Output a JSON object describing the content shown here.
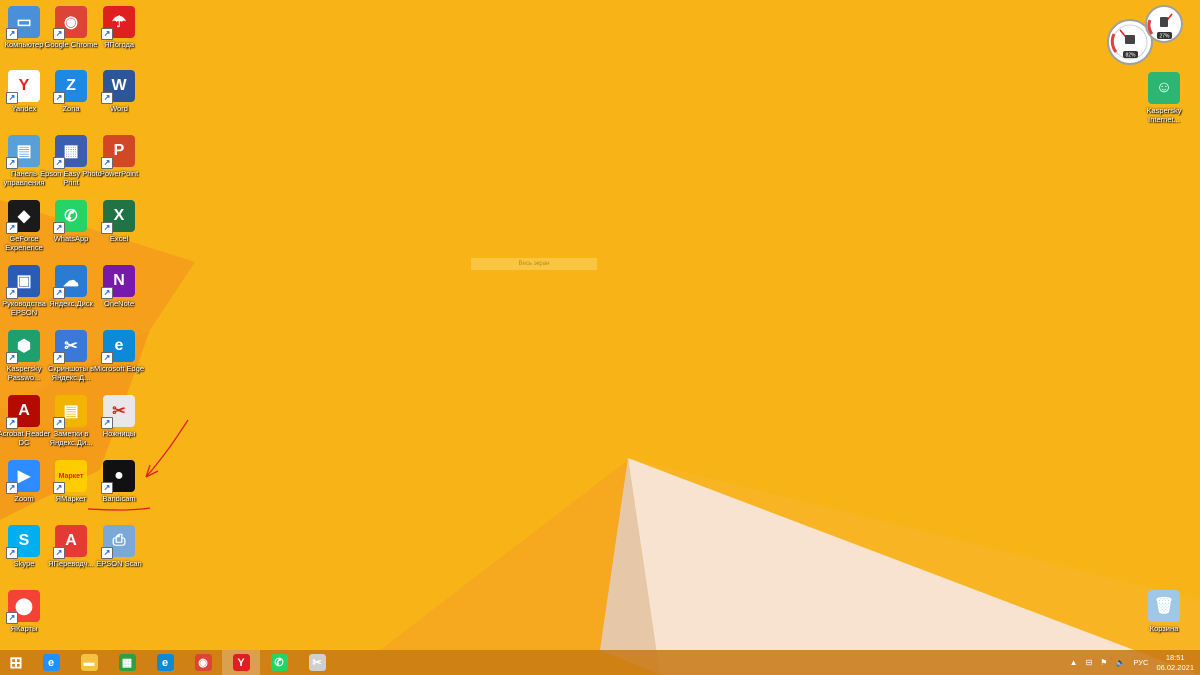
{
  "desktop": {
    "icons": [
      {
        "label": "Компьютер",
        "icon": "computer-icon",
        "color": "#4a8fd8",
        "glyph": "▭"
      },
      {
        "label": "Google Chrome",
        "icon": "chrome-icon",
        "color": "#db4437",
        "glyph": "◉"
      },
      {
        "label": "ЯПогода",
        "icon": "umbrella-icon",
        "color": "#e02020",
        "glyph": "☂"
      },
      {
        "label": "Yandex",
        "icon": "yandex-browser-icon",
        "color": "#ffffff",
        "glyph": "Y"
      },
      {
        "label": "Zona",
        "icon": "zona-icon",
        "color": "#1e88e5",
        "glyph": "Z"
      },
      {
        "label": "Word",
        "icon": "word-icon",
        "color": "#2b579a",
        "glyph": "W"
      },
      {
        "label": "Панель управления",
        "icon": "control-panel-icon",
        "color": "#5aa0d8",
        "glyph": "▤"
      },
      {
        "label": "Epson Easy Photo Print",
        "icon": "epson-photo-icon",
        "color": "#3a5fb0",
        "glyph": "▦"
      },
      {
        "label": "PowerPoint",
        "icon": "powerpoint-icon",
        "color": "#d24726",
        "glyph": "P"
      },
      {
        "label": "GeForce Experience",
        "icon": "geforce-icon",
        "color": "#1a1a1a",
        "glyph": "◆"
      },
      {
        "label": "WhatsApp",
        "icon": "whatsapp-icon",
        "color": "#25d366",
        "glyph": "✆"
      },
      {
        "label": "Excel",
        "icon": "excel-icon",
        "color": "#217346",
        "glyph": "X"
      },
      {
        "label": "Руководства EPSON",
        "icon": "epson-manual-icon",
        "color": "#2a5cb5",
        "glyph": "▣"
      },
      {
        "label": "Яндекс.Диск",
        "icon": "yandex-disk-icon",
        "color": "#2a7bd4",
        "glyph": "☁"
      },
      {
        "label": "OneNote",
        "icon": "onenote-icon",
        "color": "#7719aa",
        "glyph": "N"
      },
      {
        "label": "Kaspersky Passwo...",
        "icon": "kaspersky-password-icon",
        "color": "#1f9e6e",
        "glyph": "⬢"
      },
      {
        "label": "Скриншоты в Яндекс.Д...",
        "icon": "screenshot-icon",
        "color": "#3b78d8",
        "glyph": "✂"
      },
      {
        "label": "Microsoft Edge",
        "icon": "edge-icon",
        "color": "#0c8ad8",
        "glyph": "e"
      },
      {
        "label": "Acrobat Reader DC",
        "icon": "acrobat-icon",
        "color": "#b30b00",
        "glyph": "A"
      },
      {
        "label": "Заметки в Яндекс.Ди...",
        "icon": "notes-icon",
        "color": "#f2b400",
        "glyph": "▤"
      },
      {
        "label": "Ножницы",
        "icon": "scissors-icon",
        "color": "#e8e8e8",
        "glyph": "✂"
      },
      {
        "label": "Zoom",
        "icon": "zoom-icon",
        "color": "#2d8cff",
        "glyph": "▶"
      },
      {
        "label": "ЯМаркет",
        "icon": "market-icon",
        "color": "#ffcc00",
        "glyph": "Маркет"
      },
      {
        "label": "Bandicam",
        "icon": "bandicam-icon",
        "color": "#111111",
        "glyph": "●"
      },
      {
        "label": "Skype",
        "icon": "skype-icon",
        "color": "#00aff0",
        "glyph": "S"
      },
      {
        "label": "ЯПереводч...",
        "icon": "translator-icon",
        "color": "#e53935",
        "glyph": "A"
      },
      {
        "label": "EPSON Scan",
        "icon": "epson-scan-icon",
        "color": "#7aa9d8",
        "glyph": "⎙"
      },
      {
        "label": "ЯКарты",
        "icon": "maps-icon",
        "color": "#f44336",
        "glyph": "⬤"
      }
    ],
    "right_icons": [
      {
        "label": "Kaspersky Internet...",
        "icon": "kaspersky-icon",
        "color": "#2db573",
        "glyph": "☺"
      },
      {
        "label": "Корзина",
        "icon": "recycle-bin-icon",
        "color": "#9fc7e8",
        "glyph": "🗑"
      }
    ],
    "watermark": "Весь экран"
  },
  "gadget": {
    "cpu": "82%",
    "ram": "27%"
  },
  "taskbar": {
    "items": [
      {
        "icon": "windows-start-icon",
        "color": "#ffffff",
        "glyph": "⊞"
      },
      {
        "icon": "internet-explorer-icon",
        "color": "#1e90ff",
        "glyph": "e"
      },
      {
        "icon": "file-explorer-icon",
        "color": "#f5c242",
        "glyph": "▬"
      },
      {
        "icon": "store-icon",
        "color": "#2ea043",
        "glyph": "▦"
      },
      {
        "icon": "edge-icon",
        "color": "#0c8ad8",
        "glyph": "e"
      },
      {
        "icon": "chrome-icon",
        "color": "#db4437",
        "glyph": "◉"
      },
      {
        "icon": "yandex-browser-icon",
        "color": "#e02020",
        "glyph": "Y"
      },
      {
        "icon": "whatsapp-icon",
        "color": "#25d366",
        "glyph": "✆"
      },
      {
        "icon": "scissors-icon",
        "color": "#cfcfcf",
        "glyph": "✂"
      }
    ],
    "tray": {
      "lang": "РУС",
      "time": "18:51",
      "date": "06.02.2021"
    }
  }
}
